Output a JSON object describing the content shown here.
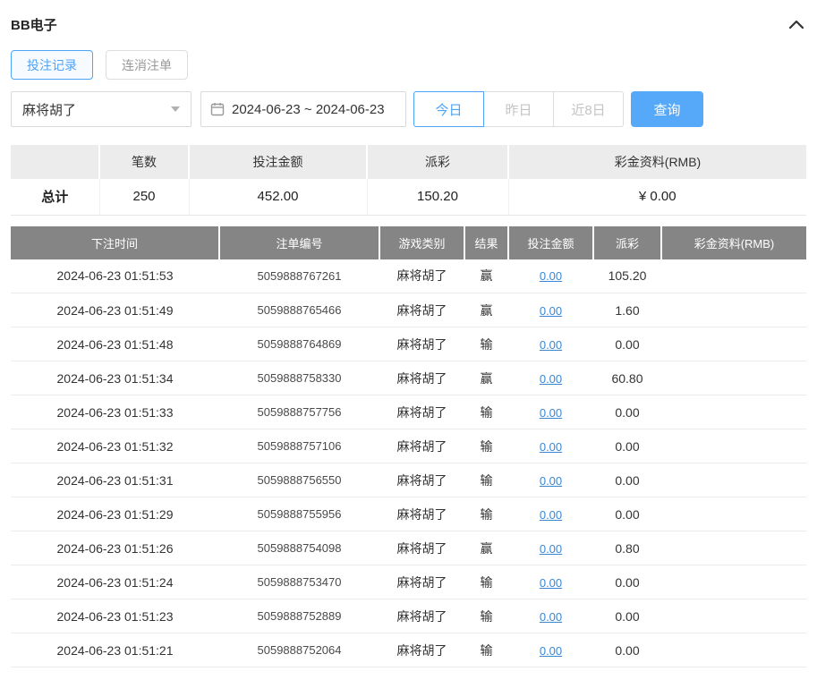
{
  "panel": {
    "title": "BB电子"
  },
  "tabs": {
    "bet_records": "投注记录",
    "chain_orders": "连消注单"
  },
  "filters": {
    "game_select_value": "麻将胡了",
    "date_range_value": "2024-06-23 ~ 2024-06-23",
    "today": "今日",
    "yesterday": "昨日",
    "last8": "近8日",
    "search": "查询"
  },
  "summary": {
    "headers": {
      "count": "笔数",
      "bet_amount": "投注金额",
      "payout": "派彩",
      "bonus": "彩金资料(RMB)"
    },
    "total_label": "总计",
    "count": "250",
    "bet_amount": "452.00",
    "payout": "150.20",
    "bonus": "¥ 0.00"
  },
  "records": {
    "headers": {
      "time": "下注时间",
      "order": "注单编号",
      "game": "游戏类别",
      "result": "结果",
      "bet": "投注金额",
      "payout": "派彩",
      "bonus": "彩金资料(RMB)"
    },
    "rows": [
      {
        "time": "2024-06-23 01:51:53",
        "order_id": "5059888767261",
        "game": "麻将胡了",
        "result": "赢",
        "bet": "0.00",
        "payout": "105.20",
        "bonus": ""
      },
      {
        "time": "2024-06-23 01:51:49",
        "order_id": "5059888765466",
        "game": "麻将胡了",
        "result": "赢",
        "bet": "0.00",
        "payout": "1.60",
        "bonus": ""
      },
      {
        "time": "2024-06-23 01:51:48",
        "order_id": "5059888764869",
        "game": "麻将胡了",
        "result": "输",
        "bet": "0.00",
        "payout": "0.00",
        "bonus": ""
      },
      {
        "time": "2024-06-23 01:51:34",
        "order_id": "5059888758330",
        "game": "麻将胡了",
        "result": "赢",
        "bet": "0.00",
        "payout": "60.80",
        "bonus": ""
      },
      {
        "time": "2024-06-23 01:51:33",
        "order_id": "5059888757756",
        "game": "麻将胡了",
        "result": "输",
        "bet": "0.00",
        "payout": "0.00",
        "bonus": ""
      },
      {
        "time": "2024-06-23 01:51:32",
        "order_id": "5059888757106",
        "game": "麻将胡了",
        "result": "输",
        "bet": "0.00",
        "payout": "0.00",
        "bonus": ""
      },
      {
        "time": "2024-06-23 01:51:31",
        "order_id": "5059888756550",
        "game": "麻将胡了",
        "result": "输",
        "bet": "0.00",
        "payout": "0.00",
        "bonus": ""
      },
      {
        "time": "2024-06-23 01:51:29",
        "order_id": "5059888755956",
        "game": "麻将胡了",
        "result": "输",
        "bet": "0.00",
        "payout": "0.00",
        "bonus": ""
      },
      {
        "time": "2024-06-23 01:51:26",
        "order_id": "5059888754098",
        "game": "麻将胡了",
        "result": "赢",
        "bet": "0.00",
        "payout": "0.80",
        "bonus": ""
      },
      {
        "time": "2024-06-23 01:51:24",
        "order_id": "5059888753470",
        "game": "麻将胡了",
        "result": "输",
        "bet": "0.00",
        "payout": "0.00",
        "bonus": ""
      },
      {
        "time": "2024-06-23 01:51:23",
        "order_id": "5059888752889",
        "game": "麻将胡了",
        "result": "输",
        "bet": "0.00",
        "payout": "0.00",
        "bonus": ""
      },
      {
        "time": "2024-06-23 01:51:21",
        "order_id": "5059888752064",
        "game": "麻将胡了",
        "result": "输",
        "bet": "0.00",
        "payout": "0.00",
        "bonus": ""
      }
    ]
  }
}
